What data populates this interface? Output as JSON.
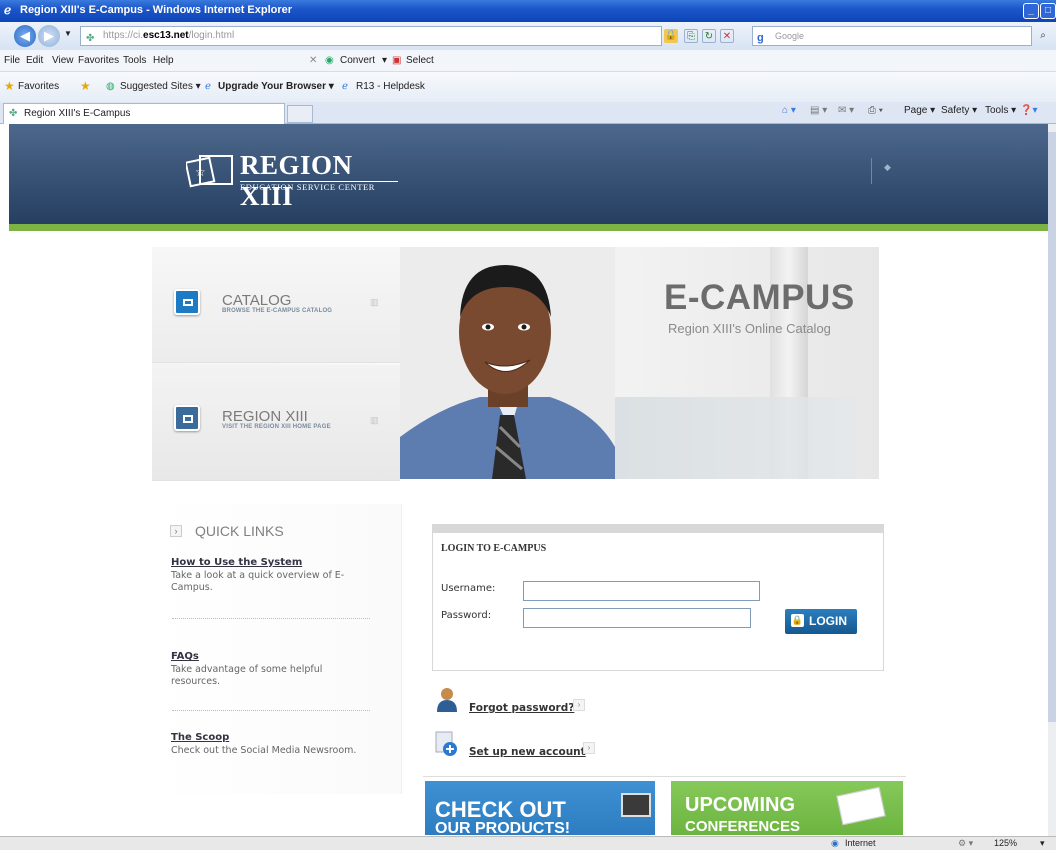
{
  "window": {
    "title": "Region XIII's E-Campus - Windows Internet Explorer"
  },
  "address": {
    "prefix": "https://",
    "host_pre": "ci.",
    "host": "esc13.net",
    "path": "/login.html"
  },
  "search": {
    "placeholder": "Google"
  },
  "menu": {
    "items": [
      "File",
      "Edit",
      "View",
      "Favorites",
      "Tools",
      "Help"
    ],
    "convert": "Convert",
    "select": "Select"
  },
  "favorites": {
    "label": "Favorites",
    "items": [
      "Suggested Sites ▾",
      "Upgrade Your Browser ▾",
      "R13 - Helpdesk"
    ]
  },
  "tab": {
    "label": "Region XIII's E-Campus"
  },
  "command_bar": {
    "items": [
      "Page ▾",
      "Safety ▾",
      "Tools ▾"
    ]
  },
  "header": {
    "logo_title": "REGION XIII",
    "logo_subtitle": "EDUCATION SERVICE CENTER"
  },
  "hero": {
    "tiles": [
      {
        "label": "CATALOG",
        "sub": "BROWSE THE E-CAMPUS CATALOG"
      },
      {
        "label": "REGION XIII",
        "sub": "VISIT THE REGION XIII HOME PAGE"
      }
    ],
    "title": "E-CAMPUS",
    "subtitle": "Region XIII's Online Catalog"
  },
  "quick_links": {
    "heading": "QUICK LINKS",
    "items": [
      {
        "title": "How to Use the System",
        "desc": "Take a look at a quick overview of E-Campus."
      },
      {
        "title": "FAQs",
        "desc": "Take advantage of some helpful resources."
      },
      {
        "title": "The Scoop",
        "desc": "Check out the Social Media Newsroom."
      }
    ]
  },
  "login": {
    "title": "LOGIN TO E-CAMPUS",
    "username_label": "Username:",
    "password_label": "Password:",
    "button": "LOGIN",
    "forgot": "Forgot password?",
    "new_account": "Set up new account"
  },
  "banners": {
    "left_line1": "CHECK OUT",
    "left_line2": "OUR PRODUCTS!",
    "right_line1": "UPCOMING",
    "right_line2": "CONFERENCES"
  },
  "status": {
    "zone": "Internet",
    "zoom": "125%"
  }
}
